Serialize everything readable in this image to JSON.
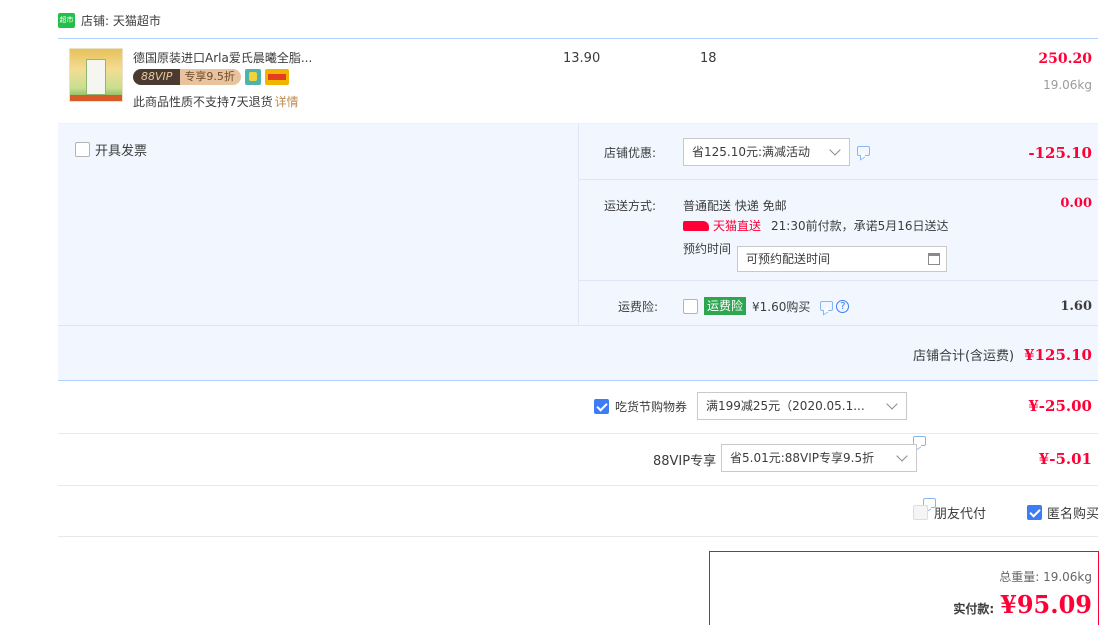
{
  "shop": {
    "logo_text": "超市",
    "label": "店铺: 天猫超市"
  },
  "item": {
    "title": "德国原装进口Arla爱氏晨曦全脂...",
    "vip_tag": "88VIP",
    "vip_discount": "专享9.5折",
    "notice": "此商品性质不支持7天退货",
    "notice_link": "详情",
    "unit_price": "13.90",
    "quantity": "18",
    "subtotal": "250.20",
    "weight": "19.06kg"
  },
  "invoice": {
    "label": "开具发票"
  },
  "shop_discount": {
    "label": "店铺优惠:",
    "select": "省125.10元:满减活动",
    "amount": "-125.10"
  },
  "shipping": {
    "label": "运送方式:",
    "method": "普通配送 快递 免邮",
    "amount": "0.00",
    "tmall_direct": "天猫直送",
    "promise": "21:30前付款，承诺5月16日送达",
    "appointment_label": "预约时间",
    "appointment_value": "可预约配送时间"
  },
  "insurance": {
    "label": "运费险:",
    "tag": "运费险",
    "price": "¥1.60购买",
    "help": "?",
    "amount": "1.60"
  },
  "shop_total": {
    "label": "店铺合计(含运费)",
    "amount": "¥125.10"
  },
  "coupon": {
    "label": "吃货节购物券",
    "select": "满199减25元（2020.05.1...",
    "amount": "¥-25.00"
  },
  "vip": {
    "label": "88VIP专享",
    "select": "省5.01元:88VIP专享9.5折",
    "amount": "¥-5.01"
  },
  "options": {
    "friend_pay": "朋友代付",
    "anonymous": "匿名购买"
  },
  "pay": {
    "weight_label": "总重量: 19.06kg",
    "actual_label": "实付款:",
    "actual_amount": "¥95.09"
  },
  "colors": {
    "accent": "#ff0036",
    "blue": "#3e7cf6",
    "panel": "#f2f7ff"
  }
}
